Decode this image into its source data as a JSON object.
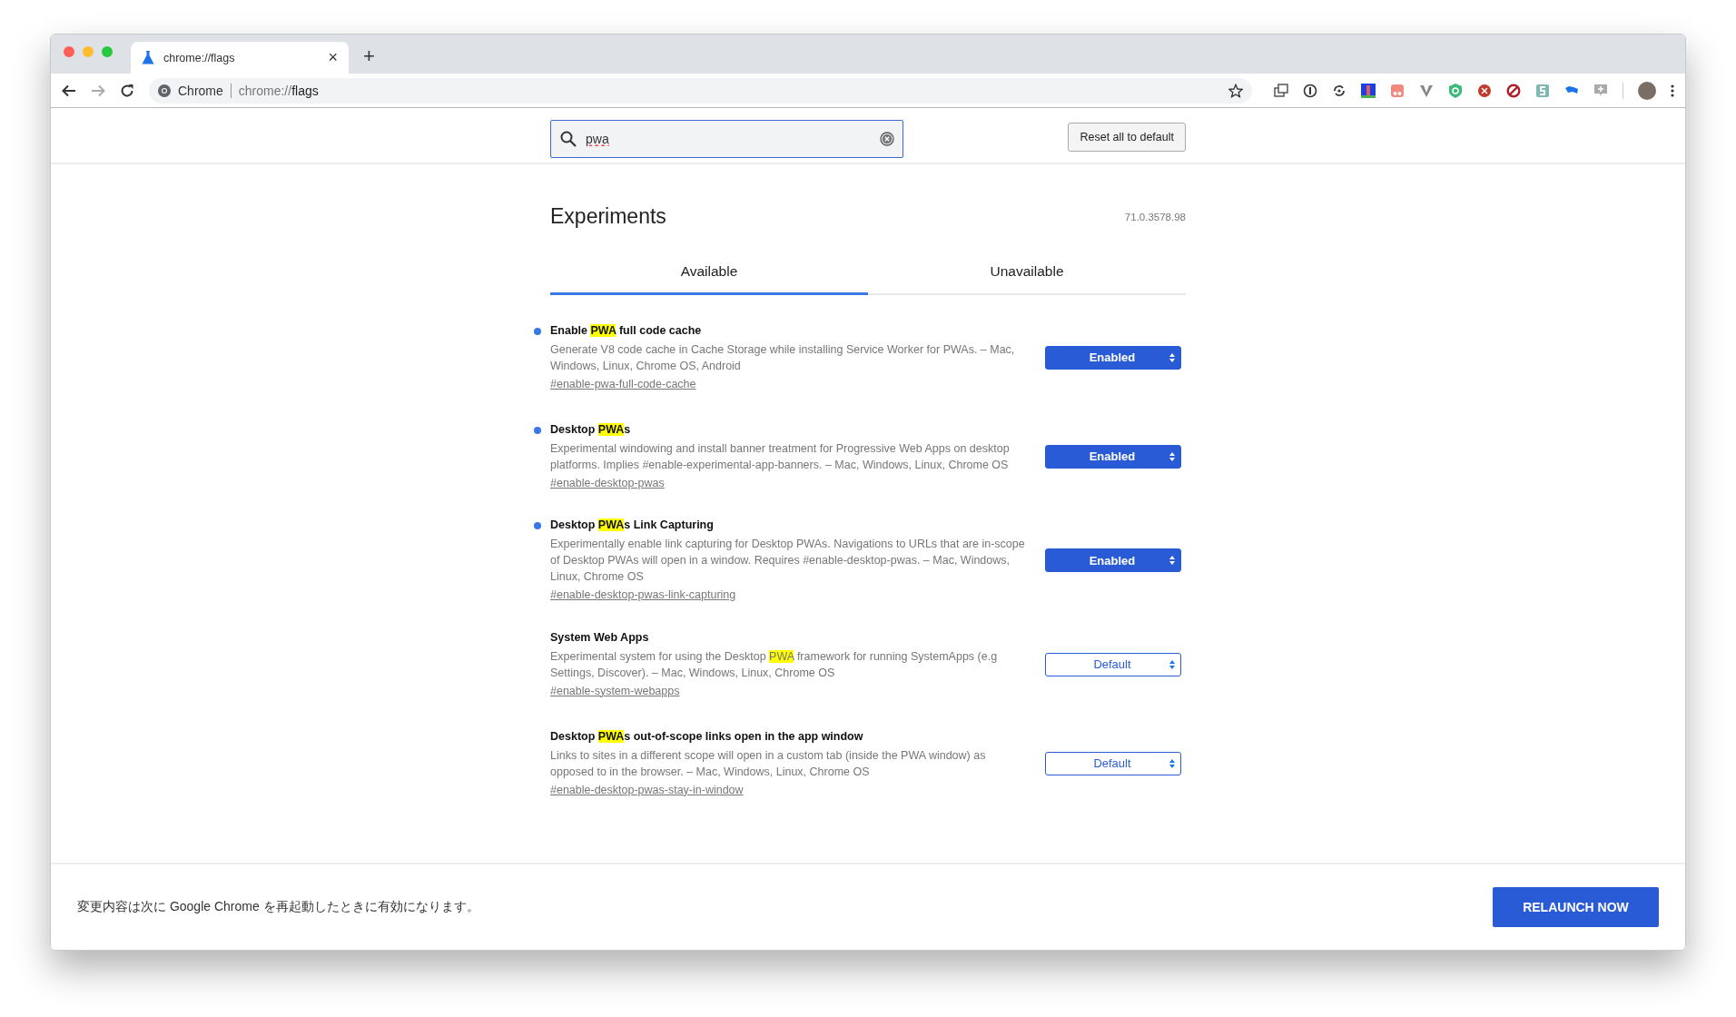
{
  "tab": {
    "title": "chrome://flags",
    "close": "×",
    "new_tab": "+"
  },
  "omnibox": {
    "site": "Chrome",
    "url_prefix": "chrome://",
    "url_path": "flags"
  },
  "search": {
    "value": "pwa"
  },
  "reset_button": "Reset all to default",
  "heading": "Experiments",
  "version": "71.0.3578.98",
  "tabs": [
    {
      "label": "Available",
      "selected": true
    },
    {
      "label": "Unavailable",
      "selected": false
    }
  ],
  "features": [
    {
      "title": [
        {
          "text": "Enable ",
          "highlight": false
        },
        {
          "text": "PWA",
          "highlight": true
        },
        {
          "text": " full code cache",
          "highlight": false
        }
      ],
      "description": [
        {
          "text": "Generate V8 code cache in Cache Storage while installing Service Worker for PWAs. – Mac, Windows, Linux, Chrome OS, Android",
          "highlight": false
        }
      ],
      "link": "#enable-pwa-full-code-cache",
      "value": "Enabled",
      "modified": true
    },
    {
      "title": [
        {
          "text": "Desktop ",
          "highlight": false
        },
        {
          "text": "PWA",
          "highlight": true
        },
        {
          "text": "s",
          "highlight": false
        }
      ],
      "description": [
        {
          "text": "Experimental windowing and install banner treatment for Progressive Web Apps on desktop platforms. Implies #enable-experimental-app-banners. – Mac, Windows, Linux, Chrome OS",
          "highlight": false
        }
      ],
      "link": "#enable-desktop-pwas",
      "value": "Enabled",
      "modified": true
    },
    {
      "title": [
        {
          "text": "Desktop ",
          "highlight": false
        },
        {
          "text": "PWA",
          "highlight": true
        },
        {
          "text": "s Link Capturing",
          "highlight": false
        }
      ],
      "description": [
        {
          "text": "Experimentally enable link capturing for Desktop PWAs. Navigations to URLs that are in-scope of Desktop PWAs will open in a window. Requires #enable-desktop-pwas. – Mac, Windows, Linux, Chrome OS",
          "highlight": false
        }
      ],
      "link": "#enable-desktop-pwas-link-capturing",
      "value": "Enabled",
      "modified": true
    },
    {
      "title": [
        {
          "text": "System Web Apps",
          "highlight": false
        }
      ],
      "description": [
        {
          "text": "Experimental system for using the Desktop ",
          "highlight": false
        },
        {
          "text": "PWA",
          "highlight": true
        },
        {
          "text": " framework for running SystemApps (e.g Settings, Discover). – Mac, Windows, Linux, Chrome OS",
          "highlight": false
        }
      ],
      "link": "#enable-system-webapps",
      "value": "Default",
      "modified": false
    },
    {
      "title": [
        {
          "text": "Desktop ",
          "highlight": false
        },
        {
          "text": "PWA",
          "highlight": true
        },
        {
          "text": "s out-of-scope links open in the app window",
          "highlight": false
        }
      ],
      "description": [
        {
          "text": "Links to sites in a different scope will open in a custom tab (inside the PWA window) as opposed to in the browser. – Mac, Windows, Linux, Chrome OS",
          "highlight": false
        }
      ],
      "link": "#enable-desktop-pwas-stay-in-window",
      "value": "Default",
      "modified": false
    }
  ],
  "footer": {
    "message": "変更内容は次に Google Chrome を再起動したときに有効になります。",
    "button": "RELAUNCH NOW"
  }
}
